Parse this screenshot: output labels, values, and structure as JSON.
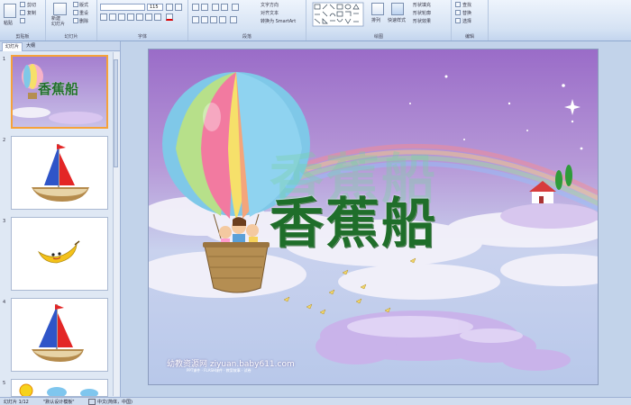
{
  "ribbon": {
    "clipboard": {
      "paste": "粘贴",
      "cut": "剪切",
      "copy": "复制",
      "label": "剪贴板"
    },
    "slides": {
      "new_slide": "新建\n幻灯片",
      "layout": "版式",
      "reset": "重设",
      "delete": "删除",
      "label": "幻灯片"
    },
    "font": {
      "size": "115",
      "label": "字体"
    },
    "paragraph": {
      "text_direction": "文字方向",
      "align_text": "对齐文本",
      "smartart": "转换为 SmartArt",
      "label": "段落"
    },
    "drawing": {
      "arrange": "排列",
      "quick_styles": "快速样式",
      "shape_fill": "形状填充",
      "shape_outline": "形状轮廓",
      "shape_effects": "形状效果",
      "label": "绘图"
    },
    "editing": {
      "find": "查找",
      "replace": "替换",
      "select": "选择",
      "label": "编辑"
    }
  },
  "panel": {
    "tabs": [
      "幻灯片",
      "大纲"
    ],
    "thumbs": [
      {
        "num": "1",
        "title": "香蕉船"
      },
      {
        "num": "2"
      },
      {
        "num": "3"
      },
      {
        "num": "4"
      },
      {
        "num": "5"
      }
    ]
  },
  "slide": {
    "title": "香蕉船",
    "watermark": "幼教资源网 ziyuan.baby611.com",
    "watermark_sub": "PPT课件 · FLASH课件 · 教案故事 · 试卷"
  },
  "status": {
    "slide_num": "幻灯片 1/12",
    "theme": "\"默认设计模板\"",
    "lang": "中文(简体，中国)"
  }
}
